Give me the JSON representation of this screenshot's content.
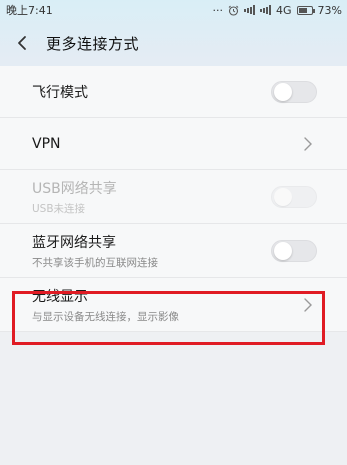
{
  "status_bar": {
    "time": "晚上7:41",
    "dots": "···",
    "network": "4G",
    "battery_percent": "73%",
    "battery_level": 0.73,
    "icons": [
      "alarm-icon",
      "signal-icon",
      "signal-icon",
      "battery-icon"
    ]
  },
  "header": {
    "back_icon": "back-arrow-icon",
    "title": "更多连接方式"
  },
  "settings": {
    "airplane": {
      "label": "飞行模式",
      "toggle_on": false
    },
    "vpn": {
      "label": "VPN"
    },
    "usb_tether": {
      "label": "USB网络共享",
      "sub": "USB未连接",
      "enabled": false
    },
    "bt_tether": {
      "label": "蓝牙网络共享",
      "sub": "不共享该手机的互联网连接",
      "toggle_on": false
    },
    "wireless_display": {
      "label": "无线显示",
      "sub": "与显示设备无线连接，显示影像"
    }
  },
  "annotation": {
    "color": "#e01b24"
  }
}
